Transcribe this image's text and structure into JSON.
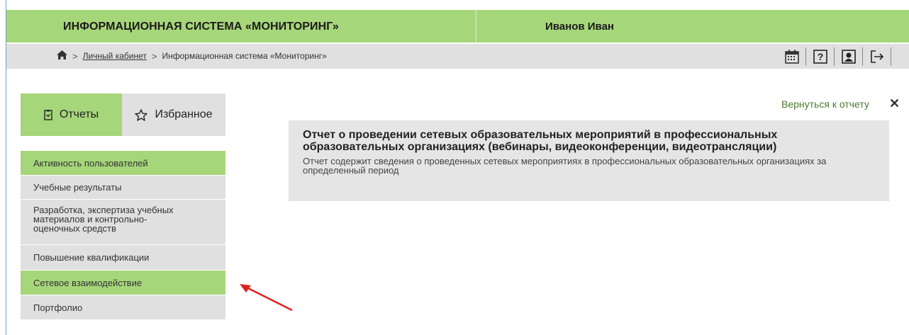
{
  "header": {
    "app_title": "ИНФОРМАЦИОННАЯ СИСТЕМА «МОНИТОРИНГ»",
    "user_name": "Иванов Иван"
  },
  "breadcrumb": {
    "home_icon": "home-icon",
    "items": [
      "Личный кабинет",
      "Информационная система «Мониторинг»"
    ],
    "separator": ">"
  },
  "toolbar": {
    "icons": [
      "calendar-icon",
      "help-icon",
      "profile-icon",
      "logout-icon"
    ],
    "help_label": "?"
  },
  "tabs": {
    "reports_label": "Отчеты",
    "favorites_label": "Избранное"
  },
  "menu": {
    "items": [
      {
        "label": "Активность пользователей",
        "active": true
      },
      {
        "label": "Учебные результаты",
        "active": false
      },
      {
        "label": "Разработка, экспертиза учебных материалов и контрольно-оценочных средств",
        "active": false
      },
      {
        "label": "Повышение квалификации",
        "active": false
      },
      {
        "label": "Сетевое взаимодействие",
        "active": true
      },
      {
        "label": "Портфолио",
        "active": false
      }
    ]
  },
  "content": {
    "back_link": "Вернуться к отчету",
    "close_symbol": "✕",
    "report_title": "Отчет о проведении сетевых образовательных мероприятий в профессиональных образовательных организациях (вебинары, видеоконференции, видеотрансляции)",
    "report_description": "Отчет содержит сведения о проведенных сетевых мероприятиях в профессиональных образовательных организациях за определенный период"
  },
  "colors": {
    "accent_green": "#a6d67a",
    "bar_gray": "#e0e0e0",
    "annotation_arrow": "#e02020"
  }
}
